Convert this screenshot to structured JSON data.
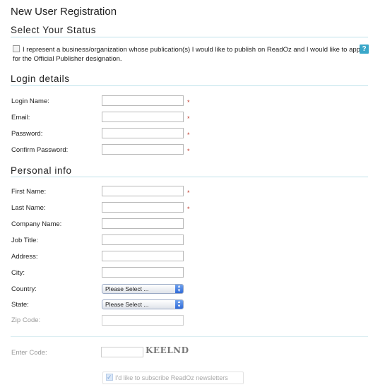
{
  "page": {
    "title": "New User Registration"
  },
  "sections": {
    "status": "Select Your Status",
    "login": "Login details",
    "personal": "Personal info"
  },
  "status_option": {
    "text": "I represent a business/organization whose publication(s) I would like to publish on ReadOz and I would like to apply for the Official Publisher designation.",
    "help": "?"
  },
  "login_fields": [
    {
      "label": "Login Name:",
      "value": "",
      "required": true
    },
    {
      "label": "Email:",
      "value": "",
      "required": true
    },
    {
      "label": "Password:",
      "value": "",
      "required": true
    },
    {
      "label": "Confirm Password:",
      "value": "",
      "required": true
    }
  ],
  "personal_fields": [
    {
      "label": "First Name:",
      "value": "",
      "required": true
    },
    {
      "label": "Last Name:",
      "value": "",
      "required": true
    },
    {
      "label": "Company Name:",
      "value": ""
    },
    {
      "label": "Job Title:",
      "value": ""
    },
    {
      "label": "Address:",
      "value": ""
    },
    {
      "label": "City:",
      "value": ""
    }
  ],
  "selects": {
    "country": {
      "label": "Country:",
      "value": "Please Select ..."
    },
    "state": {
      "label": "State:",
      "value": "Please Select ..."
    }
  },
  "zip": {
    "label": "Zip Code:",
    "value": ""
  },
  "captcha": {
    "label": "Enter Code:",
    "code": "KEELND",
    "value": ""
  },
  "newsletter": {
    "label": "I'd like to subscribe ReadOz newsletters"
  },
  "required_marker": "*",
  "colors": {
    "required": "#c0392b",
    "help": "#3aa7c9",
    "rule": "#bfe2ea"
  }
}
